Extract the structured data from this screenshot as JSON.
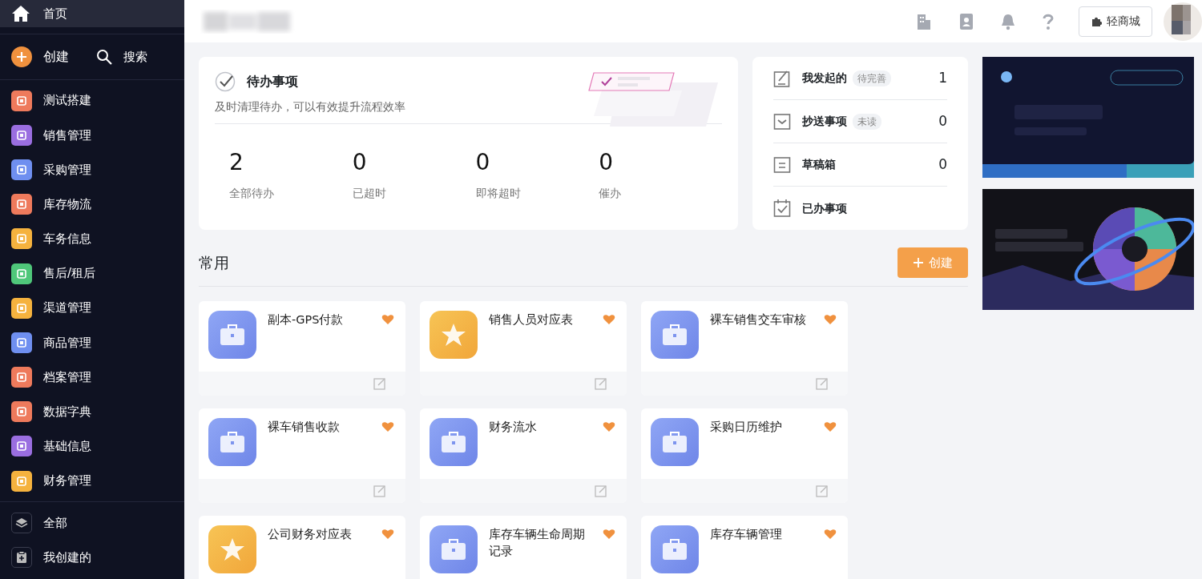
{
  "sidebar": {
    "home": {
      "label": "首页",
      "selected": true
    },
    "create": "创建",
    "search": "搜索",
    "apps": [
      {
        "label": "测试搭建",
        "color": "#ee7a5c",
        "selected": false
      },
      {
        "label": "销售管理",
        "color": "#9a6ee0",
        "selected": false
      },
      {
        "label": "采购管理",
        "color": "#6f8ff0",
        "selected": false
      },
      {
        "label": "库存物流",
        "color": "#ee7a5c",
        "selected": false
      },
      {
        "label": "车务信息",
        "color": "#f5b23e",
        "selected": false
      },
      {
        "label": "售后/租后",
        "color": "#4fc77a",
        "selected": false
      },
      {
        "label": "渠道管理",
        "color": "#f5b23e",
        "selected": false
      },
      {
        "label": "商品管理",
        "color": "#6f8ff0",
        "selected": false
      },
      {
        "label": "档案管理",
        "color": "#ee7a5c",
        "selected": false
      },
      {
        "label": "数据字典",
        "color": "#ee7a5c",
        "selected": false
      },
      {
        "label": "基础信息",
        "color": "#9a6ee0",
        "selected": false
      },
      {
        "label": "财务管理",
        "color": "#f5b23e",
        "selected": false
      }
    ],
    "footer": [
      {
        "label": "全部",
        "kind": "layers"
      },
      {
        "label": "我创建的",
        "kind": "clipboard"
      }
    ]
  },
  "header": {
    "mall_button": "轻商城"
  },
  "todo": {
    "title": "待办事项",
    "subtitle": "及时清理待办，可以有效提升流程效率",
    "stats": [
      {
        "value": "2",
        "label": "全部待办"
      },
      {
        "value": "0",
        "label": "已超时"
      },
      {
        "value": "0",
        "label": "即将超时"
      },
      {
        "value": "0",
        "label": "催办"
      }
    ]
  },
  "tasks": [
    {
      "kind": "initiated",
      "label": "我发起的",
      "badge": "待完善",
      "count": "1"
    },
    {
      "kind": "cc",
      "label": "抄送事项",
      "badge": "未读",
      "count": "0"
    },
    {
      "kind": "drafts",
      "label": "草稿箱",
      "count": "0"
    },
    {
      "kind": "done",
      "label": "已办事项"
    }
  ],
  "common": {
    "title": "常用",
    "create_button": "创建",
    "apps": [
      {
        "kind": "form",
        "name": "副本-GPS付款",
        "favorite": true
      },
      {
        "kind": "report",
        "name": "销售人员对应表",
        "favorite": true
      },
      {
        "kind": "form",
        "name": "裸车销售交车审核",
        "favorite": true
      },
      {
        "kind": "form",
        "name": "裸车销售收款",
        "favorite": true
      },
      {
        "kind": "form",
        "name": "财务流水",
        "favorite": true
      },
      {
        "kind": "form",
        "name": "采购日历维护",
        "favorite": true
      },
      {
        "kind": "report",
        "name": "公司财务对应表",
        "favorite": true
      },
      {
        "kind": "form",
        "name": "库存车辆生命周期记录",
        "favorite": true
      },
      {
        "kind": "form",
        "name": "库存车辆管理",
        "favorite": true
      }
    ]
  }
}
